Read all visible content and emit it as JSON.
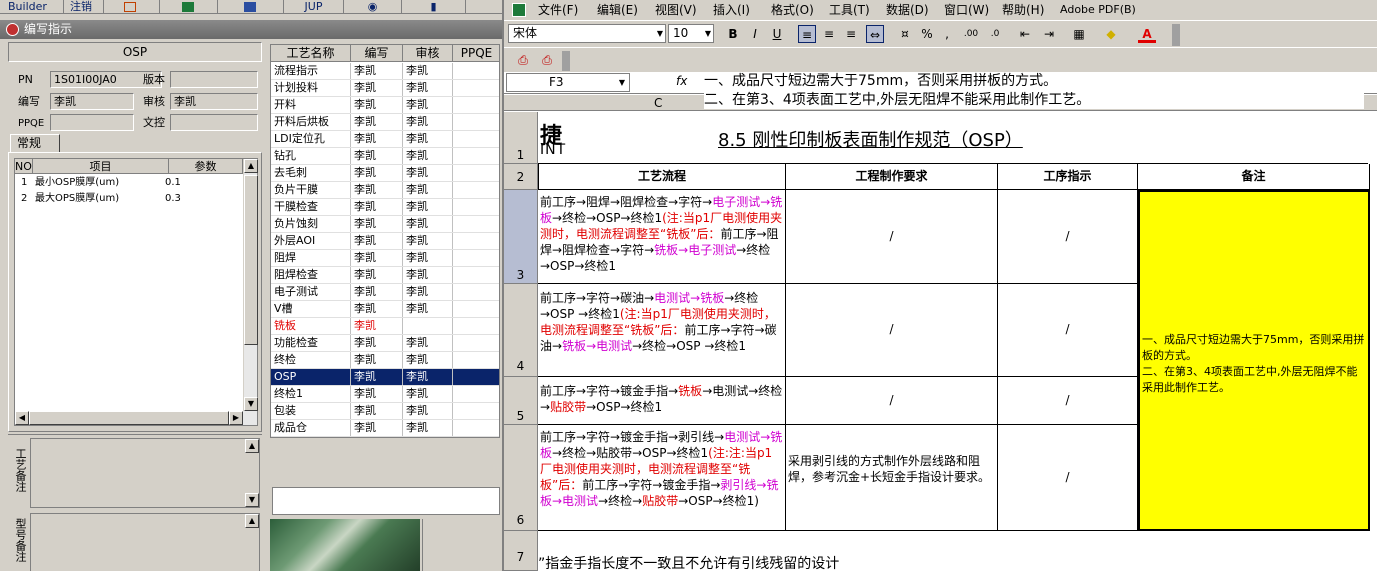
{
  "left_toolbar": {
    "builder": "Builder",
    "cancel": "注销",
    "jup": "JUP"
  },
  "window_title": "编写指示",
  "header_panel": {
    "section_title": "OSP",
    "pn_label": "PN",
    "pn_value": "1S01I00JA0",
    "version_label": "版本",
    "version_value": "",
    "author_label": "编写",
    "author_value": "李凯",
    "review_label": "审核",
    "review_value": "李凯",
    "ppqe_label": "PPQE",
    "ppqe_value": "",
    "doc_label": "文控",
    "doc_value": ""
  },
  "tab_general": "常规",
  "param_table": {
    "headers": [
      "NO",
      "项目",
      "参数"
    ],
    "rows": [
      {
        "no": "1",
        "item": "最小OSP膜厚(um)",
        "value": "0.1"
      },
      {
        "no": "2",
        "item": "最大OPS膜厚(um)",
        "value": "0.3"
      }
    ]
  },
  "remarks": {
    "process_label": "工艺备注",
    "model_label": "型号备注"
  },
  "process_table": {
    "headers": [
      "工艺名称",
      "编写",
      "审核",
      "PPQE"
    ],
    "rows": [
      {
        "name": "流程指示",
        "author": "李凯",
        "review": "李凯"
      },
      {
        "name": "计划投料",
        "author": "李凯",
        "review": "李凯"
      },
      {
        "name": "开料",
        "author": "李凯",
        "review": "李凯"
      },
      {
        "name": "开料后烘板",
        "author": "李凯",
        "review": "李凯"
      },
      {
        "name": "LDI定位孔",
        "author": "李凯",
        "review": "李凯"
      },
      {
        "name": "钻孔",
        "author": "李凯",
        "review": "李凯"
      },
      {
        "name": "去毛刺",
        "author": "李凯",
        "review": "李凯"
      },
      {
        "name": "负片干膜",
        "author": "李凯",
        "review": "李凯"
      },
      {
        "name": "干膜检查",
        "author": "李凯",
        "review": "李凯"
      },
      {
        "name": "负片蚀刻",
        "author": "李凯",
        "review": "李凯"
      },
      {
        "name": "外层AOI",
        "author": "李凯",
        "review": "李凯"
      },
      {
        "name": "阻焊",
        "author": "李凯",
        "review": "李凯"
      },
      {
        "name": "阻焊检查",
        "author": "李凯",
        "review": "李凯"
      },
      {
        "name": "电子测试",
        "author": "李凯",
        "review": "李凯"
      },
      {
        "name": "V槽",
        "author": "李凯",
        "review": "李凯"
      },
      {
        "name": "铣板",
        "author": "李凯",
        "review": ""
      },
      {
        "name": "功能检查",
        "author": "李凯",
        "review": "李凯"
      },
      {
        "name": "终检",
        "author": "李凯",
        "review": "李凯"
      },
      {
        "name": "OSP",
        "author": "李凯",
        "review": "李凯"
      },
      {
        "name": "终检1",
        "author": "李凯",
        "review": "李凯"
      },
      {
        "name": "包装",
        "author": "李凯",
        "review": "李凯"
      },
      {
        "name": "成品仓",
        "author": "李凯",
        "review": "李凯"
      }
    ]
  },
  "excel": {
    "menu": [
      "文件(F)",
      "编辑(E)",
      "视图(V)",
      "插入(I)",
      "格式(O)",
      "工具(T)",
      "数据(D)",
      "窗口(W)",
      "帮助(H)",
      "Adobe PDF(B)"
    ],
    "font_name": "宋体",
    "font_size": "10",
    "name_box": "F3",
    "fx": "fx",
    "formula_line1": "一、成品尺寸短边需大于75mm，否则采用拼板的方式。",
    "formula_line2": "二、在第3、4项表面工艺中,外层无阻焊不能采用此制作工艺。",
    "col_c": "C",
    "logo_text": "捷",
    "logo_sub": "INT",
    "title": "8.5 刚性印制板表面制作规范（OSP）",
    "headers": {
      "flow": "工艺流程",
      "req": "工程制作要求",
      "instr": "工序指示",
      "note": "备注"
    },
    "row3_flow_a": "前工序→阻焊→阻焊检查→字符→",
    "row3_flow_b": "电子测试→铣板",
    "row3_flow_c": "→终检→OSP→终检1",
    "row3_flow_d": "(注:当p1厂电测使用夹测时，电测流程调整至“铣板”后：",
    "row3_flow_e": "前工序→阻焊→阻焊检查→字符→",
    "row3_flow_f": "铣板→电子测试",
    "row3_flow_g": "→终检→OSP→终检1",
    "row4_flow_a": "前工序→字符→碳油→",
    "row4_flow_b": "电测试→铣板",
    "row4_flow_c": "→终检→OSP →终检1",
    "row4_flow_d": "(注:当p1厂电测使用夹测时，电测流程调整至“铣板”后：",
    "row4_flow_e": "前工序→字符→碳油→",
    "row4_flow_f": "铣板→电测试",
    "row4_flow_g": "→终检→OSP →终检1",
    "row5_flow_a": "前工序→字符→镀金手指→",
    "row5_flow_b": "铣板",
    "row5_flow_c": "→电测试→终检→",
    "row5_flow_d": "贴胶带",
    "row5_flow_e": "→OSP→终检1",
    "row6_flow_a": "前工序→字符→镀金手指→剥引线→",
    "row6_flow_b": "电测试→铣板",
    "row6_flow_c": "→终检→贴胶带→OSP→终检1",
    "row6_flow_d": "(注:注:当p1厂电测使用夹测时，电测流程调整至“铣板”后：",
    "row6_flow_e": "前工序→字符→镀金手指→",
    "row6_flow_f": "剥引线→铣板→电测试",
    "row6_flow_g": "→终检→",
    "row6_flow_h": "贴胶带",
    "row6_flow_i": "→OSP→终检1)",
    "row6_req": "采用剥引线的方式制作外层线路和阻焊，参考沉金+长短金手指设计要求。",
    "slash": "/",
    "note_text": "一、成品尺寸短边需大于75mm，否则采用拼板的方式。\n二、在第3、4项表面工艺中,外层无阻焊不能采用此制作工艺。",
    "row7_text": "”指金手指长度不一致且不允许有引线残留的设计",
    "row_numbers": [
      "1",
      "2",
      "3",
      "4",
      "5",
      "6",
      "7"
    ]
  },
  "colors": {
    "selection": "#0a246a",
    "note_fill": "#ffff00",
    "red": "#e00000",
    "magenta": "#d000d0"
  }
}
